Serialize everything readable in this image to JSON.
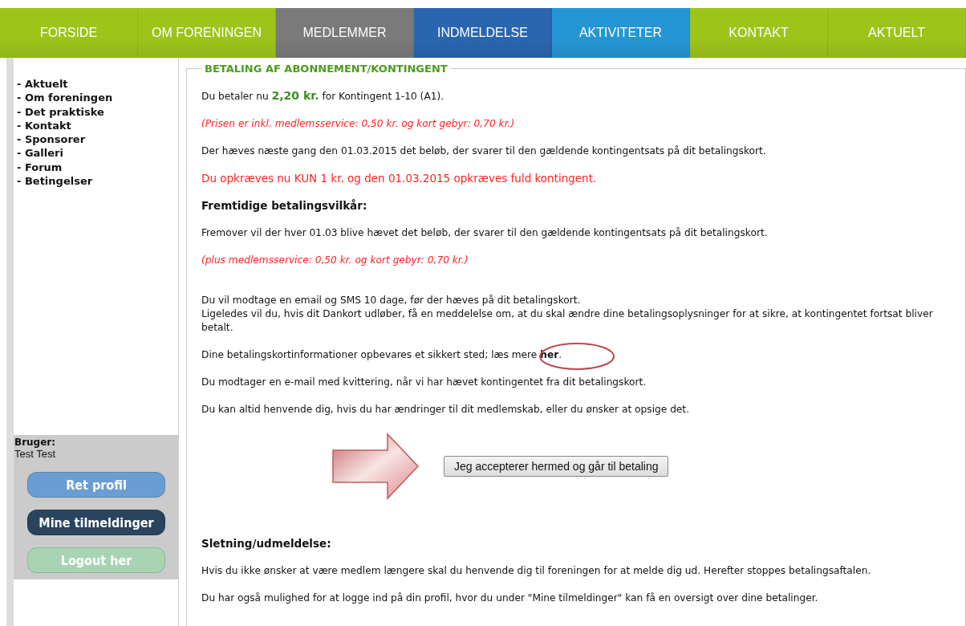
{
  "nav": [
    {
      "label": "FORSIDE",
      "color": "#9ec41a"
    },
    {
      "label": "OM FORENINGEN",
      "color": "#9ec41a"
    },
    {
      "label": "MEDLEMMER",
      "color": "#7a7a7a"
    },
    {
      "label": "INDMELDELSE",
      "color": "#2a66b0"
    },
    {
      "label": "AKTIVITETER",
      "color": "#2596d4"
    },
    {
      "label": "KONTAKT",
      "color": "#9ec41a"
    },
    {
      "label": "AKTUELT",
      "color": "#9ec41a"
    }
  ],
  "sidebar": {
    "items": [
      "- Aktuelt",
      "- Om foreningen",
      "- Det praktiske",
      "- Kontakt",
      "- Sponsorer",
      "- Galleri",
      "- Forum",
      "- Betingelser"
    ],
    "user": {
      "label": "Bruger:",
      "name": "Test Test",
      "buttons": [
        {
          "label": "Ret profil",
          "color": "#6a9ed2"
        },
        {
          "label": "Mine tilmeldinger",
          "color": "#2a445e"
        },
        {
          "label": "Logout her",
          "color": "#a8d4b4"
        }
      ]
    }
  },
  "content": {
    "title": "BETALING AF ABONNEMENT/KONTINGENT",
    "paragraphs": [
      {
        "kind": "lead",
        "lines": [
          "Du betaler nu **2,20 kr.** for Kontingent 1-10 (A1)."
        ]
      },
      {
        "kind": "note",
        "lines": [
          "(Prisen er inkl. medlemsservice: 0,50 kr. og kort gebyr: 0,70 kr.)"
        ]
      },
      {
        "kind": "text",
        "lines": [
          "Der hæves næste gang den 01.03.2015 det beløb, der svarer til den gældende kontingentsats på dit betalingskort."
        ]
      },
      {
        "kind": "alert",
        "lines": [
          "Du opkræves nu KUN 1 kr. og den 01.03.2015 opkræves fuld kontingent."
        ]
      },
      {
        "kind": "heading",
        "lines": [
          "Fremtidige betalingsvilkår:"
        ]
      },
      {
        "kind": "text",
        "lines": [
          "Fremover vil der hver 01.03 blive hævet det beløb, der svarer til den gældende kontingentsats på dit betalingskort."
        ]
      },
      {
        "kind": "note",
        "lines": [
          "(plus medlemsservice: 0,50 kr.  og kort gebyr: 0,70 kr.)"
        ]
      },
      {
        "kind": "block",
        "lines": [
          "Du vil modtage en email og SMS 10 dage, før der hæves på dit betalingskort.",
          "Ligeledes vil du, hvis dit Dankort udløber, få en meddelelse om, at du skal ændre dine betalingsoplysninger for at sikre, at kontingentet fortsat bliver betalt."
        ]
      },
      {
        "kind": "link",
        "lines": [
          "Dine betalingskortinformationer opbevares et sikkert sted; læs mere "
        ],
        "link": "her",
        "after": "."
      },
      {
        "kind": "text",
        "lines": [
          "Du modtager en e-mail med kvittering, når vi har hævet kontingentet fra dit betalingskort."
        ]
      },
      {
        "kind": "text",
        "lines": [
          "Du kan altid henvende dig, hvis du har ændringer til dit medlemskab, eller du ønsker at opsige det."
        ]
      }
    ],
    "accept_button": "Jeg accepterer hermed og går til betaling",
    "footer": [
      {
        "kind": "heading",
        "lines": [
          "Sletning/udmeldelse:"
        ]
      },
      {
        "kind": "text",
        "lines": [
          "Hvis du ikke ønsker at være medlem længere skal du henvende dig til foreningen for at melde dig ud. Herefter stoppes betalingsaftalen."
        ]
      },
      {
        "kind": "text",
        "lines": [
          "Du har også mulighed for at logge ind på din profil, hvor du under \"Mine tilmeldinger\" kan få en oversigt over dine betalinger."
        ]
      }
    ]
  }
}
